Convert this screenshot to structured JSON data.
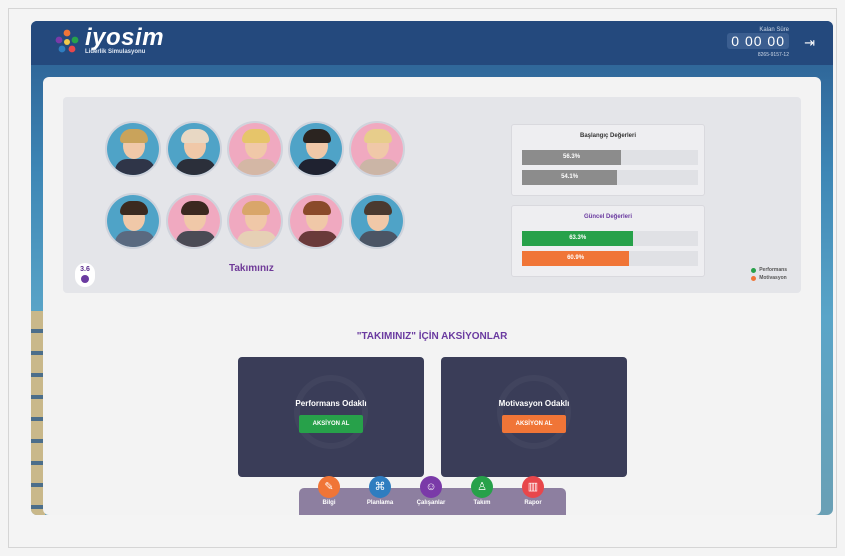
{
  "brand": {
    "name": "iyosim",
    "subtitle": "Liderlik Simulasyonu"
  },
  "timer": {
    "label": "Kalan Süre",
    "value": "0 00 00",
    "code": "8265-9157-12"
  },
  "icons": {
    "logout": "logout-icon"
  },
  "team": {
    "title": "Takımınız",
    "badge": "3.6",
    "avatars": [
      {
        "hair": "#c9a35b",
        "body": "#2f3548",
        "bg": "#4fa3c7"
      },
      {
        "hair": "#e8d8c4",
        "body": "#2b2f3a",
        "bg": "#4fa3c7"
      },
      {
        "hair": "#e6c56a",
        "body": "#d4b7a5",
        "bg": "#f0a9c0"
      },
      {
        "hair": "#2b2420",
        "body": "#1f2230",
        "bg": "#4fa3c7"
      },
      {
        "hair": "#e7cd8b",
        "body": "#cbb5a6",
        "bg": "#f0a9c0"
      },
      {
        "hair": "#3b2a20",
        "body": "#5a6a80",
        "bg": "#4fa3c7"
      },
      {
        "hair": "#3c2820",
        "body": "#4b4b55",
        "bg": "#f0a9c0"
      },
      {
        "hair": "#d9a66a",
        "body": "#e6d0b5",
        "bg": "#f0a9c0"
      },
      {
        "hair": "#8a4a2a",
        "body": "#6a3a3a",
        "bg": "#f0a9c0"
      },
      {
        "hair": "#4a3a30",
        "body": "#4b5565",
        "bg": "#4fa3c7"
      }
    ]
  },
  "initial": {
    "title": "Başlangıç Değerleri",
    "performance": "56.3%",
    "motivation": "54.1%",
    "performance_value": 56.3,
    "motivation_value": 54.1,
    "color": "#8c8c8c"
  },
  "current": {
    "title": "Güncel Değerleri",
    "performance": "63.3%",
    "motivation": "60.9%",
    "performance_value": 63.3,
    "motivation_value": 60.9,
    "performance_color": "#27a14a",
    "motivation_color": "#f07537"
  },
  "legend": {
    "performance": "Performans",
    "motivation": "Motivasyon"
  },
  "actions": {
    "title": "\"TAKIMINIZ\" İÇİN AKSİYONLAR",
    "performance": {
      "title": "Performans Odaklı",
      "button": "AKSİYON AL",
      "color": "#27a14a"
    },
    "motivation": {
      "title": "Motivasyon Odaklı",
      "button": "AKSİYON AL",
      "color": "#f07537"
    }
  },
  "dock": [
    {
      "label": "Bilgi",
      "icon": "paperclip-icon",
      "glyph": "✎",
      "color": "#f07537"
    },
    {
      "label": "Planlama",
      "icon": "nodes-icon",
      "glyph": "⌘",
      "color": "#2f7dc0"
    },
    {
      "label": "Çalışanlar",
      "icon": "people-icon",
      "glyph": "☺",
      "color": "#7a3aa8"
    },
    {
      "label": "Takım",
      "icon": "hierarchy-icon",
      "glyph": "♙",
      "color": "#27a14a"
    },
    {
      "label": "Rapor",
      "icon": "bar-chart-icon",
      "glyph": "▥",
      "color": "#e8474b"
    }
  ]
}
